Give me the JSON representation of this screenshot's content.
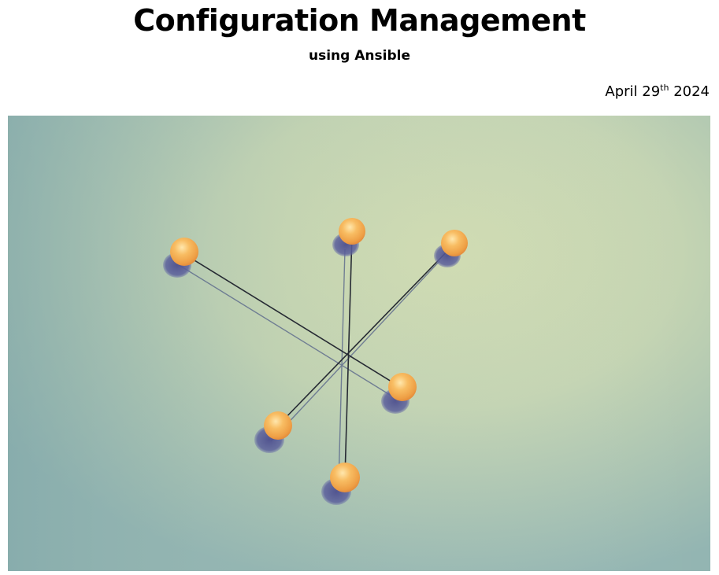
{
  "document": {
    "title": "Configuration Management",
    "subtitle": "using Ansible",
    "date": {
      "prefix": "April 29",
      "superscript": "th",
      "suffix": " 2024"
    }
  },
  "cover_image": {
    "subject": "six orange spheres joined pairwise by thin rods crossing at a central point",
    "colors": {
      "background_left": "#8fb4b1",
      "background_center": "#cfdab0",
      "background_right": "#c9d6ad",
      "sphere": "#f6b257",
      "sphere_highlight": "#ffe9b0",
      "shadow": "#5a5f9a",
      "rod": "#2a2f3a"
    }
  }
}
